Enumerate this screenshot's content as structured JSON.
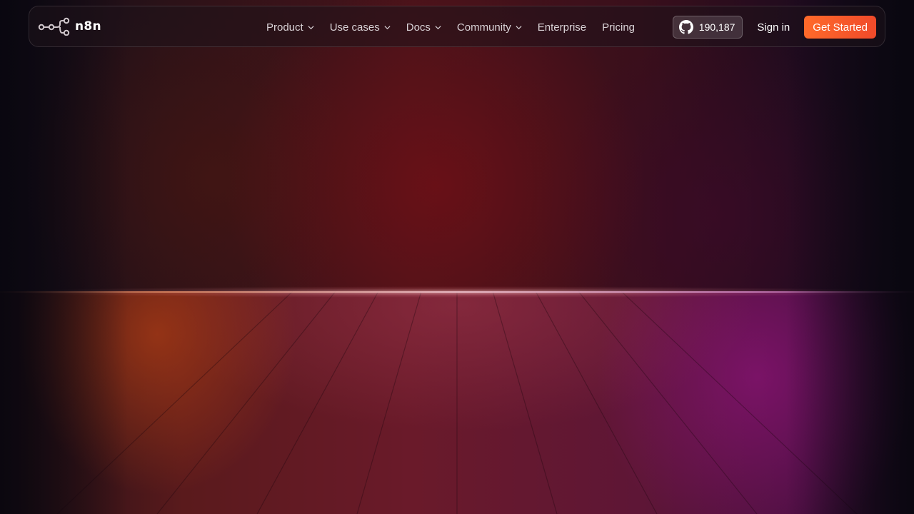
{
  "brand": {
    "name": "n8n",
    "logo_icon": "n8n-logo-icon",
    "text_color": "#ffffff"
  },
  "nav": {
    "items": [
      {
        "label": "Product",
        "has_dropdown": true
      },
      {
        "label": "Use cases",
        "has_dropdown": true
      },
      {
        "label": "Docs",
        "has_dropdown": true
      },
      {
        "label": "Community",
        "has_dropdown": true
      },
      {
        "label": "Enterprise",
        "has_dropdown": false
      },
      {
        "label": "Pricing",
        "has_dropdown": false
      }
    ]
  },
  "actions": {
    "github_icon": "github-icon",
    "github_stars": "190,187",
    "sign_in_label": "Sign in",
    "get_started_label": "Get Started"
  },
  "colors": {
    "accent": "#f4572a",
    "nav_text": "#d9d2d6"
  }
}
